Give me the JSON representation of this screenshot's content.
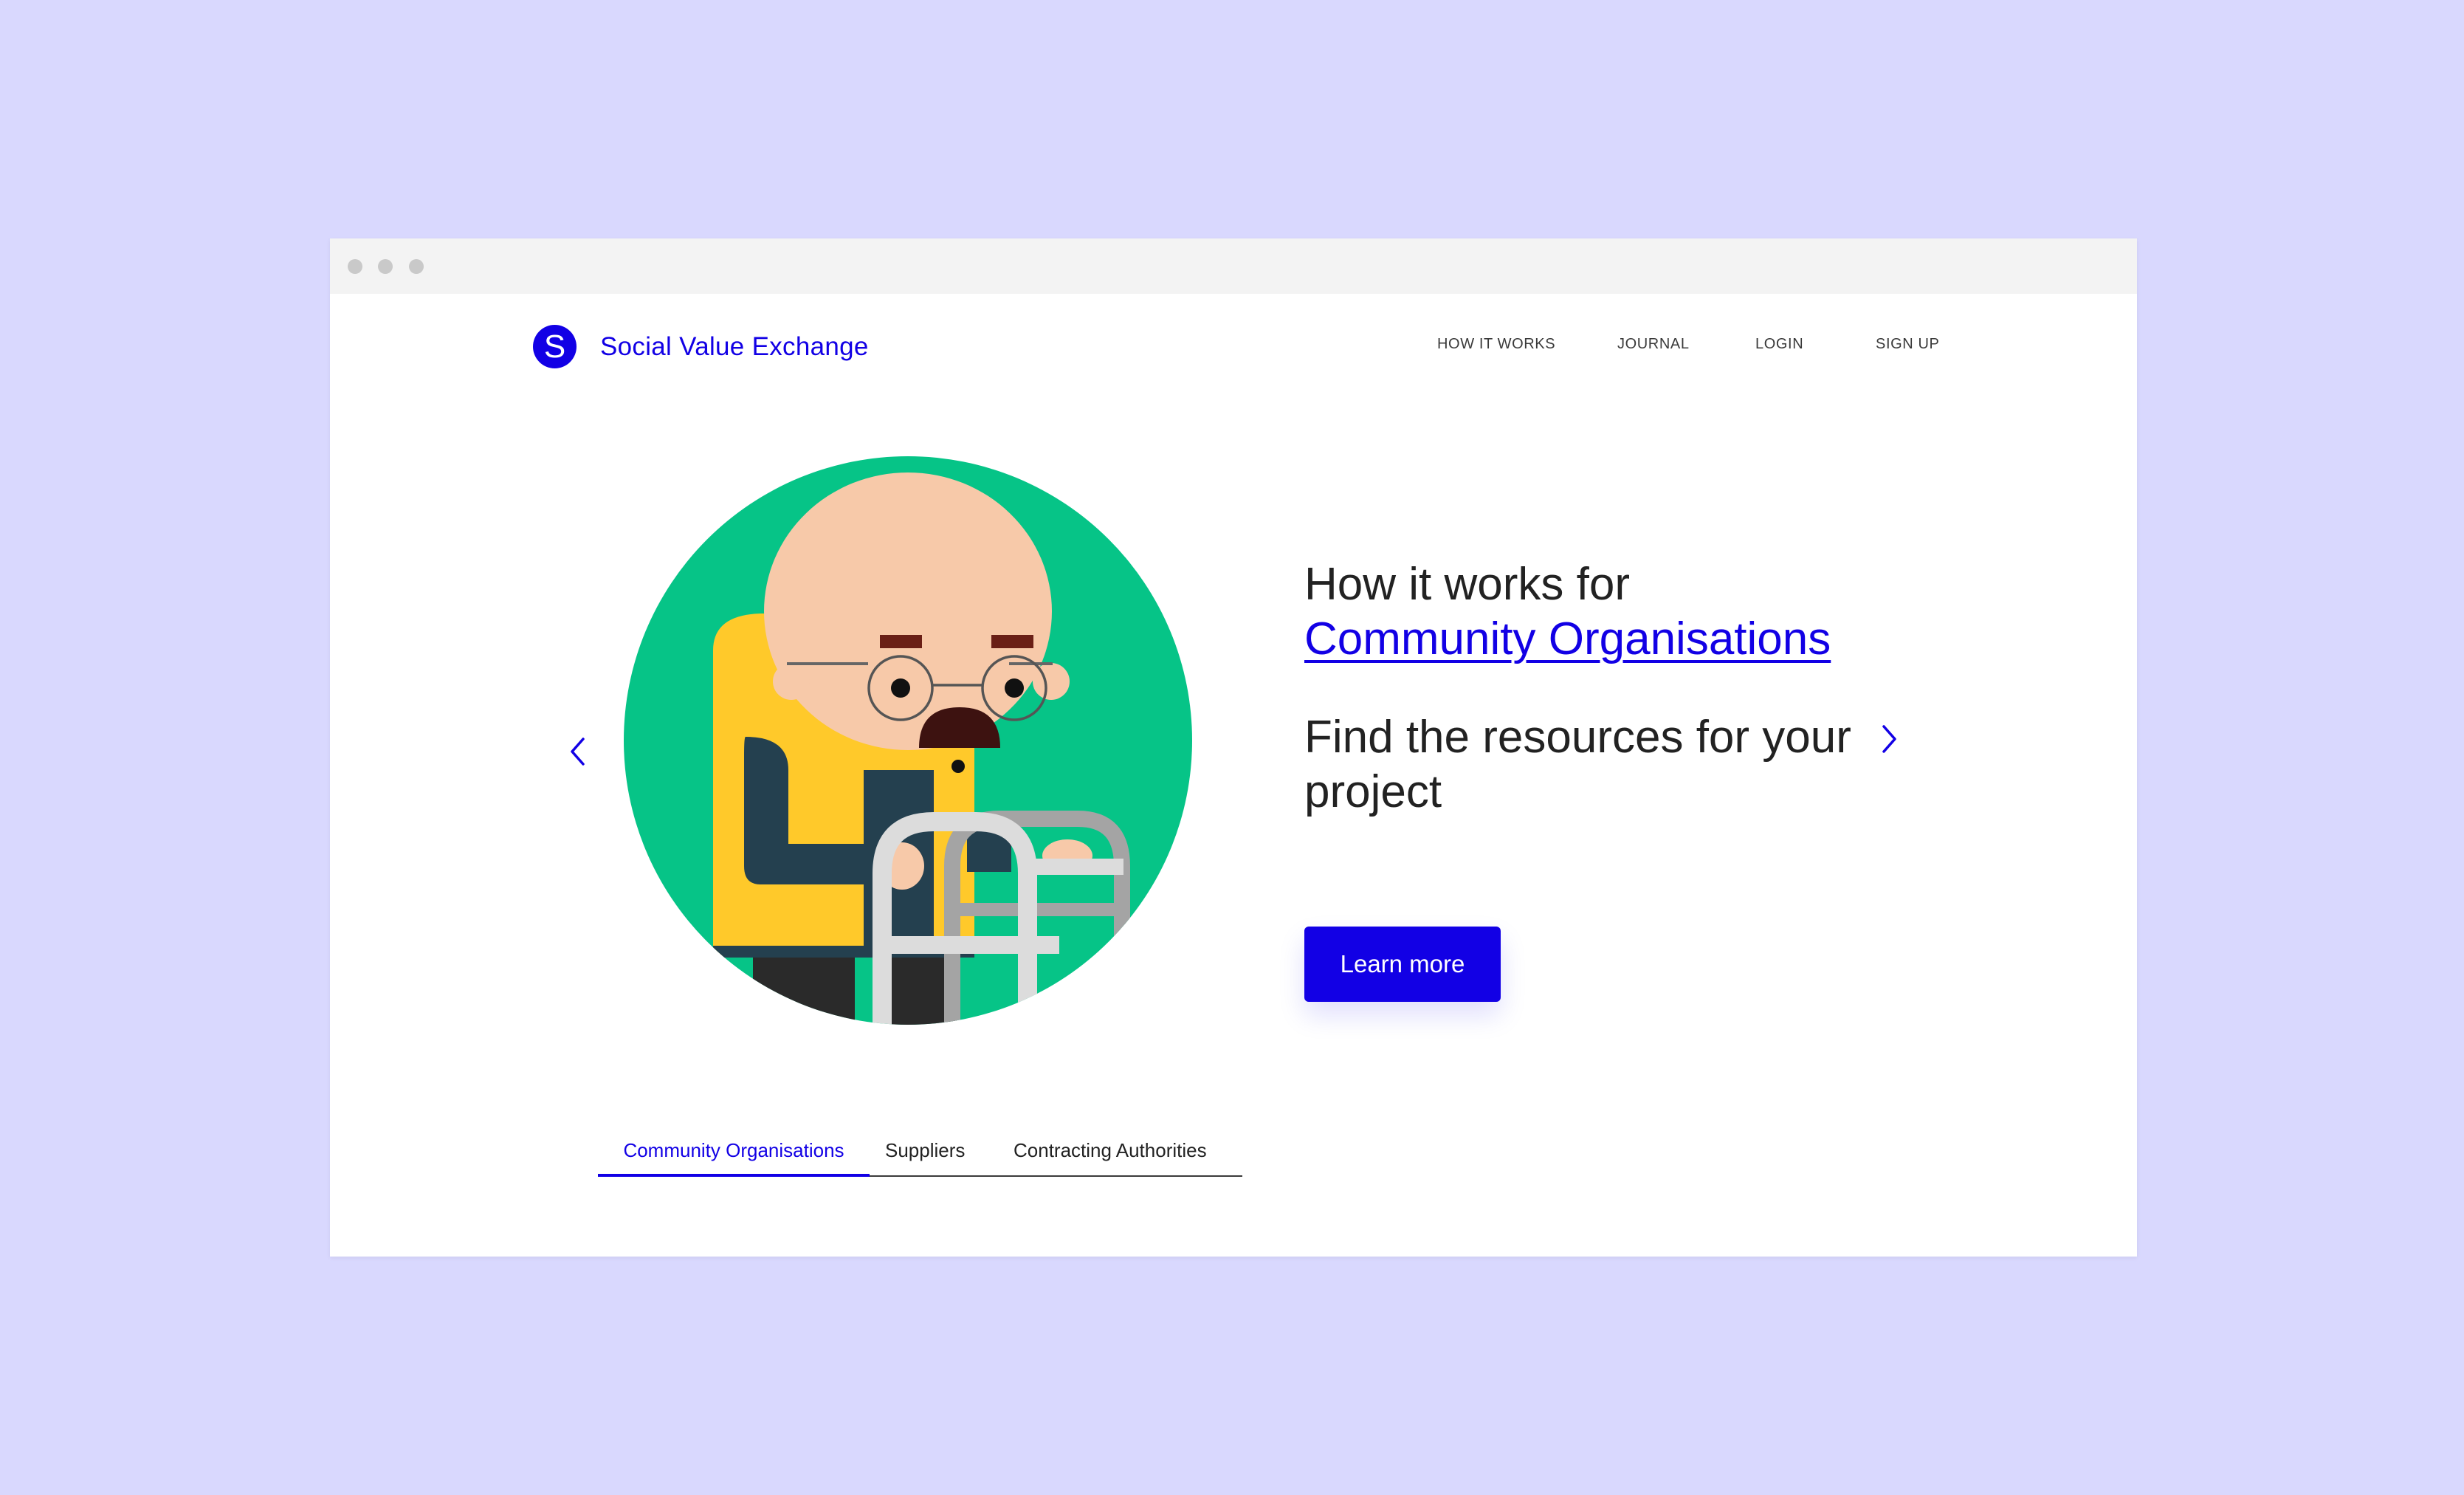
{
  "brand": {
    "name": "Social Value Exchange",
    "logo_letter": "S",
    "accent_color": "#1200e5"
  },
  "nav": {
    "items": [
      "HOW IT WORKS",
      "JOURNAL",
      "LOGIN",
      "SIGN UP"
    ]
  },
  "hero": {
    "heading_prefix": "How it works for",
    "heading_link": "Community Organisations",
    "subheading": "Find the resources for your project",
    "cta_label": "Learn more",
    "prev_icon": "chevron-left-icon",
    "next_icon": "chevron-right-icon",
    "illustration": "elderly-man-with-walking-frame"
  },
  "tabs": {
    "items": [
      "Community Organisations",
      "Suppliers",
      "Contracting Authorities"
    ],
    "active_index": 0
  },
  "colors": {
    "background": "#d9d8fe",
    "circle": "#06c487",
    "button": "#1200e5"
  }
}
